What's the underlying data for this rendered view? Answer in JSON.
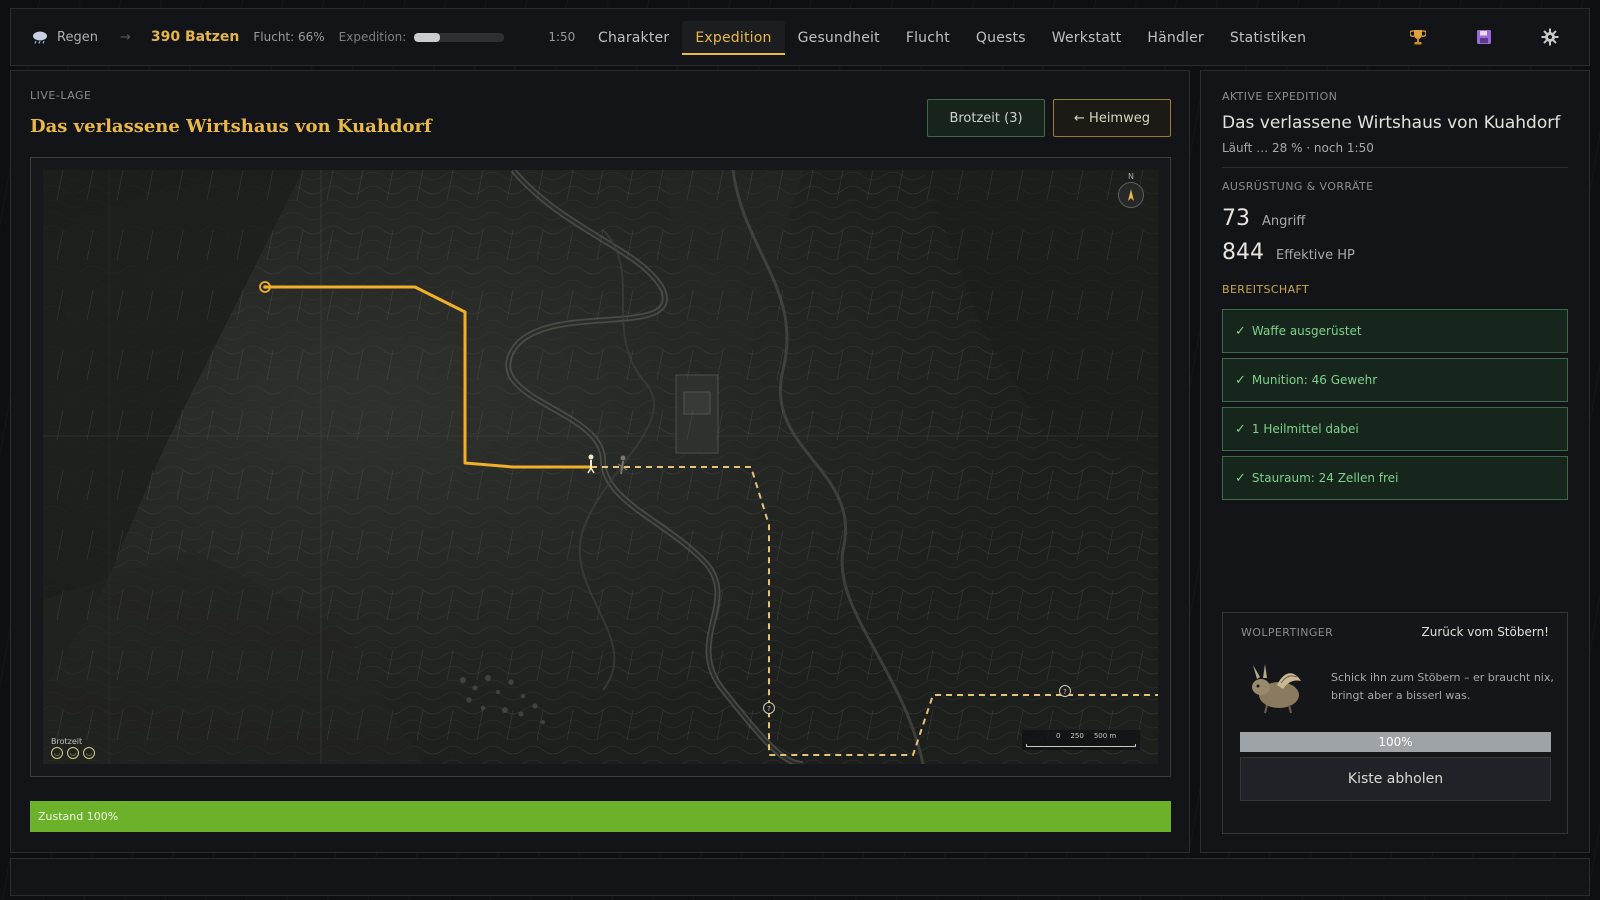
{
  "topbar": {
    "weather_label": "Regen",
    "weather_icon": "rain-cloud-icon",
    "arrow": "→",
    "batzen": "390 Batzen",
    "flucht": "Flucht: 66%",
    "expedition_label": "Expedition:",
    "expedition_progress": 0.28,
    "time": "1:50",
    "nav": [
      {
        "label": "Charakter",
        "active": false
      },
      {
        "label": "Expedition",
        "active": true
      },
      {
        "label": "Gesundheit",
        "active": false
      },
      {
        "label": "Flucht",
        "active": false
      },
      {
        "label": "Quests",
        "active": false
      },
      {
        "label": "Werkstatt",
        "active": false
      },
      {
        "label": "Händler",
        "active": false
      },
      {
        "label": "Statistiken",
        "active": false
      }
    ],
    "icons": [
      "trophy-icon",
      "save-icon",
      "gear-icon"
    ]
  },
  "live": {
    "label": "LIVE-LAGE",
    "title": "Das verlassene Wirtshaus von Kuahdorf",
    "brotzeit_button": "Brotzeit (3)",
    "heimweg_button": "← Heimweg",
    "map": {
      "compass_n": "N",
      "scale_labels": [
        "0",
        "250",
        "500 m"
      ],
      "brotzeit_label": "Brotzeit",
      "brotzeit_count": 3
    },
    "condition_label": "Zustand 100%",
    "condition_value": 1.0,
    "condition_color": "#6bb12a"
  },
  "sidebar": {
    "active_label": "AKTIVE EXPEDITION",
    "active_title": "Das verlassene Wirtshaus von Kuahdorf",
    "active_sub": "Läuft … 28 % · noch 1:50",
    "equipment_label": "AUSRÜSTUNG & VORRÄTE",
    "attack_value": "73",
    "attack_label": "Angriff",
    "hp_value": "844",
    "hp_label": "Effektive HP",
    "ready_label": "BEREITSCHAFT",
    "checks": [
      "Waffe ausgerüstet",
      "Munition: 46 Gewehr",
      "1 Heilmittel dabei",
      "Stauraum: 24 Zellen frei"
    ],
    "wolpertinger": {
      "label": "WOLPERTINGER",
      "status": "Zurück vom Stöbern!",
      "text": "Schick ihn zum Stöbern – er braucht nix, bringt aber a bisserl was.",
      "progress_label": "100%",
      "progress_value": 1.0,
      "button": "Kiste abholen"
    }
  },
  "colors": {
    "accent": "#e8b948",
    "route": "#f0b02a",
    "check_green": "#7ed08c"
  }
}
